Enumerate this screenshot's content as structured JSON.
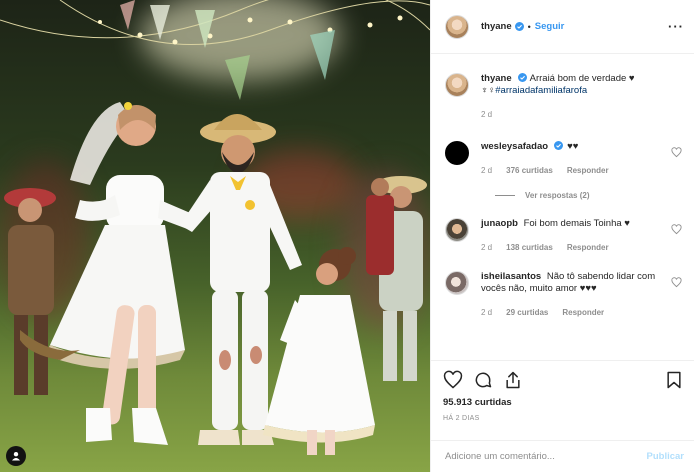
{
  "post": {
    "author": "thyane",
    "follow_label": "Seguir",
    "dot": "•",
    "more_icon": "more-options-icon",
    "caption": {
      "username": "thyane",
      "text": "Arraiá bom de verdade ♥",
      "line2_symbols": "♆♀",
      "hashtag": "#arraiadafamiliafarofa",
      "time": "2 d"
    },
    "comments": [
      {
        "username": "wesleysafadao",
        "verified": true,
        "text": "♥♥",
        "time": "2 d",
        "likes": "376 curtidas",
        "reply": "Responder",
        "view_replies": "Ver respostas (2)"
      },
      {
        "username": "junaopb",
        "verified": false,
        "text": "Foi bom demais Toinha ♥",
        "time": "2 d",
        "likes": "138 curtidas",
        "reply": "Responder"
      },
      {
        "username": "isheilasantos",
        "verified": false,
        "text": "Não tô sabendo lidar com vocês não, muito amor ♥♥♥",
        "time": "2 d",
        "likes": "29 curtidas",
        "reply": "Responder"
      }
    ],
    "likes_count": "95.913 curtidas",
    "posted_ago": "HÁ 2 DIAS",
    "comment_placeholder": "Adicione um comentário...",
    "publish_label": "Publicar"
  },
  "colors": {
    "link_blue": "#3897f0",
    "publish_disabled": "#b2dffc",
    "hashtag": "#003569",
    "secondary_text": "#8e8e8e"
  }
}
